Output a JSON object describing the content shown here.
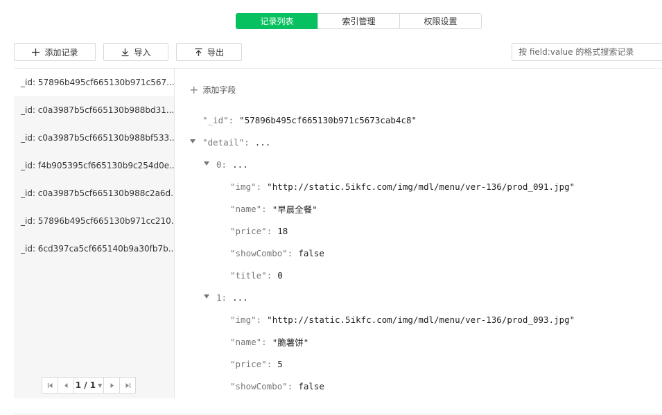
{
  "tabs": [
    {
      "label": "记录列表",
      "active": true
    },
    {
      "label": "索引管理",
      "active": false
    },
    {
      "label": "权限设置",
      "active": false
    }
  ],
  "toolbar": {
    "add_label": "添加记录",
    "import_label": "导入",
    "export_label": "导出",
    "search_placeholder": "按 field:value 的格式搜索记录"
  },
  "records": [
    "_id: 57896b495cf665130b971c567...",
    "_id: c0a3987b5cf665130b988bd31...",
    "_id: c0a3987b5cf665130b988bf533...",
    "_id: f4b905395cf665130b9c254d0e...",
    "_id: c0a3987b5cf665130b988c2a6d...",
    "_id: 57896b495cf665130b971cc210...",
    "_id: 6cd397ca5cf665140b9a30fb7b..."
  ],
  "pager": {
    "label": "1 / 1"
  },
  "detail": {
    "add_field": "添加字段",
    "id_key": "\"_id\"",
    "id_value": "\"57896b495cf665130b971c5673cab4c8\"",
    "detail_key": "\"detail\"",
    "ellipsis": "...",
    "item0_key": "0",
    "item0": {
      "img_key": "\"img\"",
      "img_value": "\"http://static.5ikfc.com/img/mdl/menu/ver-136/prod_091.jpg\"",
      "name_key": "\"name\"",
      "name_value": "\"早晨全餐\"",
      "price_key": "\"price\"",
      "price_value": "18",
      "showcombo_key": "\"showCombo\"",
      "showcombo_value": "false",
      "title_key": "\"title\"",
      "title_value": "0"
    },
    "item1_key": "1",
    "item1": {
      "img_key": "\"img\"",
      "img_value": "\"http://static.5ikfc.com/img/mdl/menu/ver-136/prod_093.jpg\"",
      "name_key": "\"name\"",
      "name_value": "\"脆薯饼\"",
      "price_key": "\"price\"",
      "price_value": "5",
      "showcombo_key": "\"showCombo\"",
      "showcombo_value": "false"
    }
  },
  "colors": {
    "accent": "#07c160",
    "sidebar_bg": "#f6f6f6",
    "border": "#d9d9d9"
  }
}
